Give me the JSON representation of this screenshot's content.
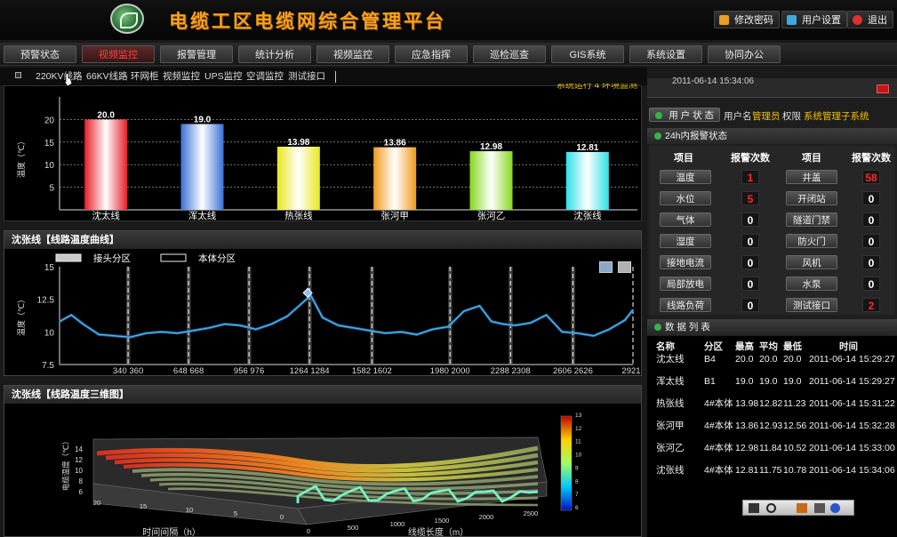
{
  "header": {
    "title": "电缆工区电缆网综合管理平台",
    "buttons": [
      {
        "label": "修改密码",
        "icon": "edit-icon",
        "color": "#e8a020"
      },
      {
        "label": "用户设置",
        "icon": "user-icon",
        "color": "#3fa9e0"
      },
      {
        "label": "退出",
        "icon": "power-icon",
        "color": "#e03030"
      }
    ]
  },
  "nav": {
    "tabs": [
      "预警状态",
      "视频监控",
      "报警管理",
      "统计分析",
      "视频监控",
      "应急指挥",
      "巡检巡查",
      "GIS系统",
      "系统设置",
      "协同办公"
    ],
    "active_index": 1
  },
  "subnav": {
    "items": [
      "220KV线路",
      "66KV线路",
      "环网柜",
      "视频监控",
      "UPS监控",
      "空调监控",
      "测试接口"
    ]
  },
  "bar_panel": {
    "partial_top_text": "系统运行 4 环境监测"
  },
  "chart_data": [
    {
      "type": "bar",
      "categories": [
        "沈太线",
        "浑太线",
        "热张线",
        "张河甲",
        "张河乙",
        "沈张线"
      ],
      "values": [
        20.0,
        19.0,
        13.98,
        13.86,
        12.98,
        12.81
      ],
      "value_labels": [
        "20.0",
        "19.0",
        "13.98",
        "13.86",
        "12.98",
        "12.81"
      ],
      "ylabel": "温度（℃）",
      "yticks": [
        5,
        10,
        15,
        20
      ],
      "ylim": [
        0,
        25
      ],
      "colors": [
        "#e61e2a",
        "#3a70d8",
        "#e8e81e",
        "#f09a1c",
        "#86d81e",
        "#2ee0e6"
      ]
    },
    {
      "type": "line",
      "title": "沈张线【线路温度曲线】",
      "ylabel": "温度（℃）",
      "yticks": [
        7.5,
        10,
        12.5,
        15
      ],
      "ylim": [
        7.5,
        15
      ],
      "xlim": [
        0,
        2921
      ],
      "legend": [
        "接头分区",
        "本体分区"
      ],
      "joint_zones": [
        [
          340,
          360
        ],
        [
          648,
          668
        ],
        [
          956,
          976
        ],
        [
          1264,
          1284
        ],
        [
          1582,
          1602
        ],
        [
          1980,
          2000
        ],
        [
          2288,
          2308
        ],
        [
          2606,
          2626
        ]
      ],
      "xtick_labels": [
        "340 360",
        "648 668",
        "956 976",
        "1264 1284",
        "1582 1602",
        "1980 2000",
        "2288 2308",
        "2606 2626",
        "2921"
      ],
      "x": [
        0,
        60,
        120,
        200,
        280,
        360,
        440,
        520,
        600,
        680,
        760,
        840,
        920,
        1000,
        1080,
        1160,
        1220,
        1280,
        1340,
        1420,
        1500,
        1580,
        1660,
        1740,
        1820,
        1900,
        1980,
        2060,
        2140,
        2200,
        2260,
        2320,
        2400,
        2480,
        2560,
        2640,
        2720,
        2800,
        2880,
        2921
      ],
      "y": [
        10.8,
        11.3,
        10.6,
        9.8,
        9.7,
        9.6,
        9.9,
        10.0,
        9.9,
        10.1,
        10.3,
        10.6,
        10.5,
        10.2,
        10.6,
        11.2,
        12.0,
        12.8,
        11.1,
        10.5,
        10.3,
        10.1,
        9.9,
        10.0,
        9.8,
        10.2,
        10.4,
        11.6,
        12.0,
        10.8,
        10.6,
        10.5,
        10.7,
        11.3,
        10.0,
        9.9,
        9.7,
        10.2,
        10.9,
        11.7
      ],
      "marker_x": 1264,
      "marker_y": 13.0
    },
    {
      "type": "heatmap",
      "title": "沈张线【线路温度三维图】",
      "zlabel": "电缆温度（℃）",
      "xlabel": "线缆长度（m）",
      "ylabel": "时间间隔（h）",
      "zticks": [
        6,
        8,
        10,
        12,
        14
      ],
      "xticks": [
        0,
        500,
        1000,
        1500,
        2000,
        2500
      ],
      "yticks": [
        0,
        5,
        10,
        15,
        20
      ],
      "colorbar_ticks": [
        6,
        7,
        8,
        9,
        10,
        11,
        12,
        13
      ]
    }
  ],
  "right": {
    "partial_top_text": "2011-06-14 15:34:06",
    "user_status": {
      "label": "用 户 状 态",
      "username_label": "用户名",
      "username": "管理员",
      "perm_label": "权限",
      "perm": "系统管理子系统"
    },
    "alarm": {
      "title": "24h内报警状态",
      "col_item": "项目",
      "col_count": "报警次数",
      "left": [
        {
          "item": "温度",
          "count": "1",
          "red": true
        },
        {
          "item": "水位",
          "count": "5",
          "red": true
        },
        {
          "item": "气体",
          "count": "0",
          "red": false
        },
        {
          "item": "湿度",
          "count": "0",
          "red": false
        },
        {
          "item": "接地电流",
          "count": "0",
          "red": false
        },
        {
          "item": "局部放电",
          "count": "0",
          "red": false
        },
        {
          "item": "线路负荷",
          "count": "0",
          "red": false
        }
      ],
      "right": [
        {
          "item": "井盖",
          "count": "58",
          "red": true
        },
        {
          "item": "开闭站",
          "count": "0",
          "red": false
        },
        {
          "item": "隧道门禁",
          "count": "0",
          "red": false
        },
        {
          "item": "防火门",
          "count": "0",
          "red": false
        },
        {
          "item": "风机",
          "count": "0",
          "red": false
        },
        {
          "item": "水泵",
          "count": "0",
          "red": false
        },
        {
          "item": "测试接口",
          "count": "2",
          "red": true
        }
      ]
    },
    "data_list": {
      "title": "数 据 列 表",
      "headers": {
        "name": "名称",
        "zone": "分区",
        "max": "最高",
        "avg": "平均",
        "min": "最低",
        "time": "时间"
      },
      "rows": [
        {
          "name": "沈太线",
          "zone": "B4",
          "max": "20.0",
          "avg": "20.0",
          "min": "20.0",
          "time": "2011-06-14 15:29:27"
        },
        {
          "name": "浑太线",
          "zone": "B1",
          "max": "19.0",
          "avg": "19.0",
          "min": "19.0",
          "time": "2011-06-14 15:29:27"
        },
        {
          "name": "热张线",
          "zone": "4#本体",
          "max": "13.98",
          "avg": "12.82",
          "min": "11.23",
          "time": "2011-06-14 15:31:22"
        },
        {
          "name": "张河甲",
          "zone": "4#本体",
          "max": "13.86",
          "avg": "12.93",
          "min": "12.56",
          "time": "2011-06-14 15:32:28"
        },
        {
          "name": "张河乙",
          "zone": "4#本体",
          "max": "12.98",
          "avg": "11.84",
          "min": "10.52",
          "time": "2011-06-14 15:33:00"
        },
        {
          "name": "沈张线",
          "zone": "4#本体",
          "max": "12.81",
          "avg": "11.75",
          "min": "10.78",
          "time": "2011-06-14 15:34:06"
        }
      ]
    }
  }
}
